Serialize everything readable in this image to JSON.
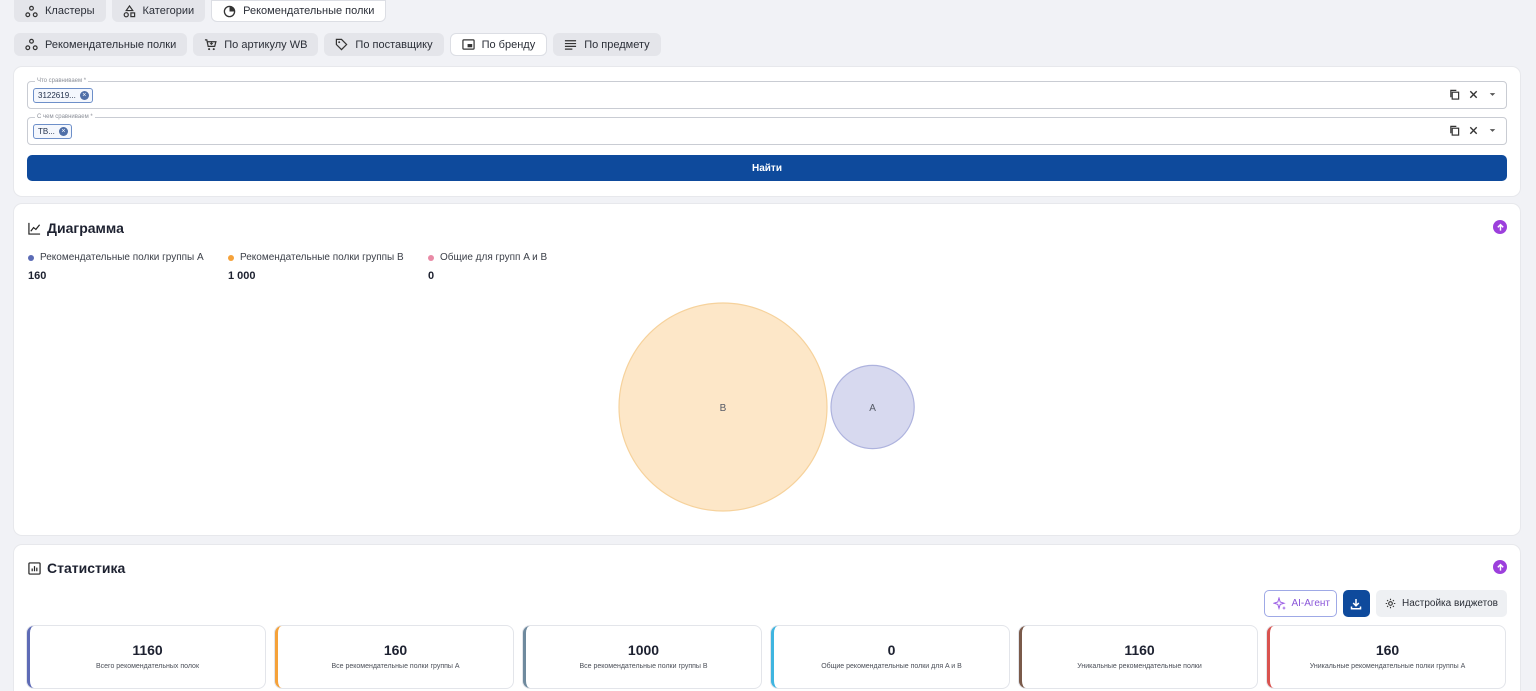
{
  "top_tabs": [
    {
      "label": "Кластеры",
      "icon": "clusters-icon",
      "active": false
    },
    {
      "label": "Категории",
      "icon": "categories-icon",
      "active": false
    },
    {
      "label": "Рекомендательные полки",
      "icon": "shelves-icon",
      "active": true
    }
  ],
  "sub_tabs": [
    {
      "label": "Рекомендательные полки",
      "icon": "clusters-icon",
      "active": false
    },
    {
      "label": "По артикулу WB",
      "icon": "cart-icon",
      "active": false
    },
    {
      "label": "По поставщику",
      "icon": "tag-icon",
      "active": false
    },
    {
      "label": "По бренду",
      "icon": "brand-icon",
      "active": true
    },
    {
      "label": "По предмету",
      "icon": "list-icon",
      "active": false
    }
  ],
  "filter": {
    "field_a": {
      "label": "Что сравниваем *",
      "chip": "3122619..."
    },
    "field_b": {
      "label": "С чем сравниваем *",
      "chip": "ТВ..."
    },
    "find_label": "Найти"
  },
  "diagram": {
    "title": "Диаграмма",
    "legend": [
      {
        "label": "Рекомендательные полки группы A",
        "value": "160",
        "color": "#5b6bb5"
      },
      {
        "label": "Рекомендательные полки группы B",
        "value": "1 000",
        "color": "#f5a23a"
      },
      {
        "label": "Общие для групп A и B",
        "value": "0",
        "color": "#e98aa6"
      }
    ]
  },
  "chart_data": {
    "type": "venn",
    "sets": [
      {
        "name": "B",
        "size": 1000,
        "fill": "#fde7c8",
        "stroke": "#f6d29c"
      },
      {
        "name": "A",
        "size": 160,
        "fill": "#d7d9ef",
        "stroke": "#aeb3de"
      }
    ],
    "intersection": 0
  },
  "stats": {
    "title": "Статистика",
    "ai_label": "AI-Агент",
    "settings_label": "Настройка виджетов",
    "cards": [
      {
        "value": "1160",
        "label": "Всего рекомендательных полок",
        "color": "#5e6bb6"
      },
      {
        "value": "160",
        "label": "Все рекомендательные полки группы A",
        "color": "#f5a23a"
      },
      {
        "value": "1000",
        "label": "Все рекомендательные полки группы B",
        "color": "#6f8a9e"
      },
      {
        "value": "0",
        "label": "Общие рекомендательные полки для A и B",
        "color": "#3fb5e0"
      },
      {
        "value": "1160",
        "label": "Уникальные рекомендательные полки",
        "color": "#7a5a4a"
      },
      {
        "value": "160",
        "label": "Уникальные рекомендательные полки группы A",
        "color": "#d9534f"
      }
    ]
  }
}
